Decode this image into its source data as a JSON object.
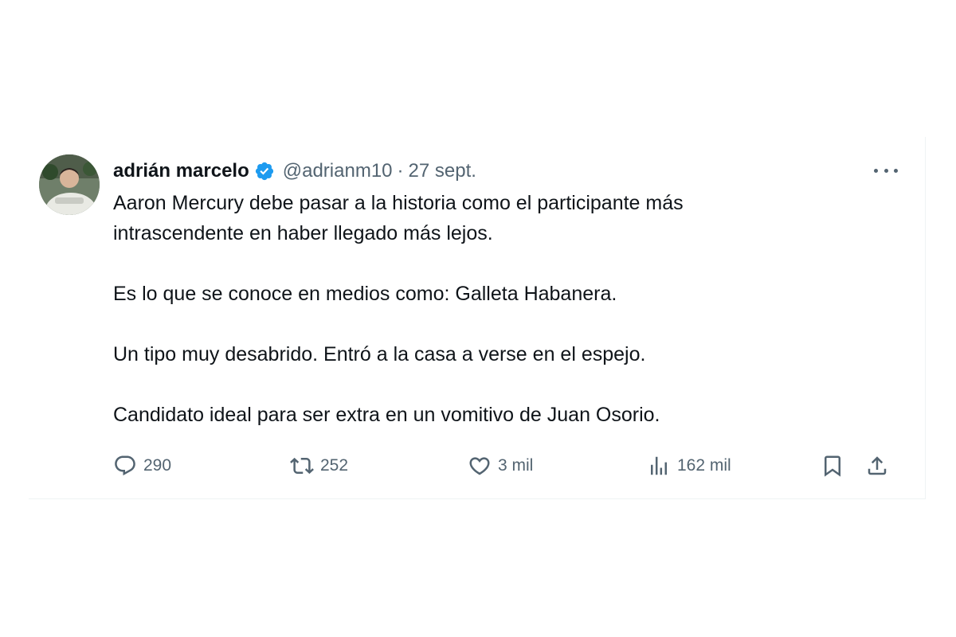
{
  "tweet": {
    "author": {
      "display_name": "adrián marcelo",
      "verified_icon": "verified-badge-icon",
      "handle": "@adrianm10",
      "separator": "·",
      "date": "27 sept."
    },
    "more_icon": "ellipsis-icon",
    "paragraphs": [
      "Aaron Mercury debe pasar a la historia como el participante más",
      "intrascendente en haber llegado más lejos.",
      "Es lo que se conoce en medios como: Galleta Habanera.",
      "Un tipo muy desabrido. Entró a la casa a verse en el espejo.",
      "Candidato ideal para ser extra en un vomitivo de Juan Osorio."
    ],
    "actions": {
      "replies": "290",
      "retweets": "252",
      "likes": "3 mil",
      "views": "162 mil"
    },
    "colors": {
      "verified": "#1d9bf0",
      "secondary_text": "#536471",
      "primary_text": "#0f1419"
    }
  }
}
